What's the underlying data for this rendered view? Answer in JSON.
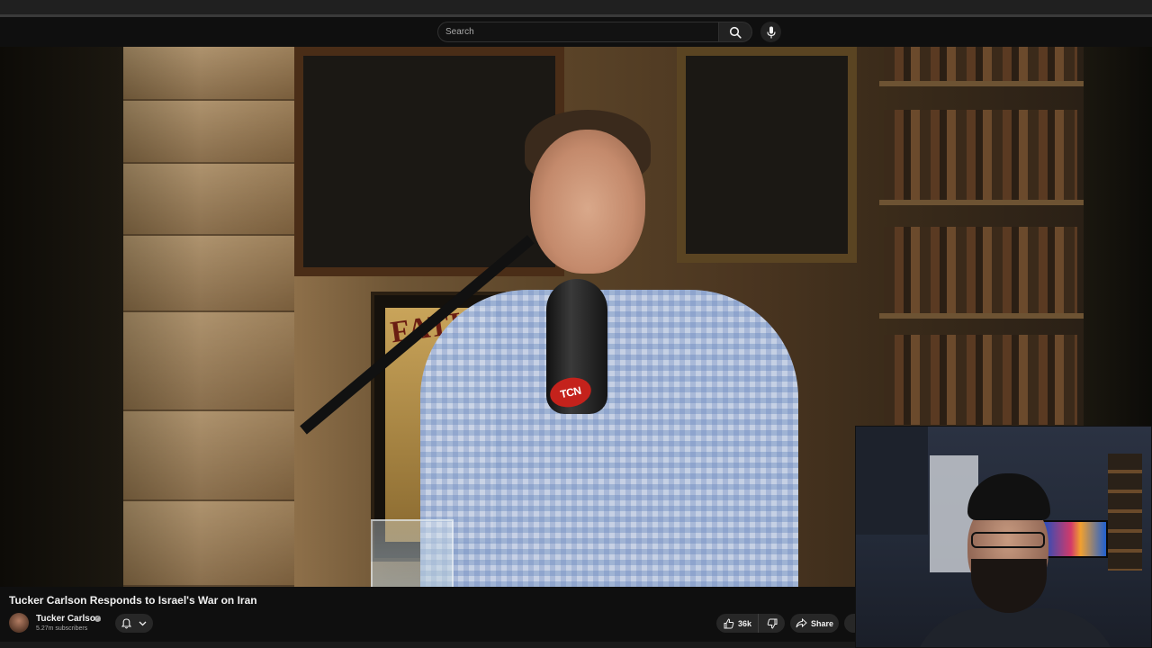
{
  "search": {
    "placeholder": "Search",
    "icon": "search-icon",
    "mic_icon": "microphone-icon"
  },
  "video": {
    "title": "Tucker Carlson Responds to Israel's War on Iran",
    "mic_badge": "TCN",
    "poster_text": "FATI"
  },
  "channel": {
    "name": "Tucker Carlson",
    "subscribers": "5.27m subscribers",
    "verified_icon": "verified-icon",
    "bell_icon": "bell-icon",
    "chevron_icon": "chevron-down-icon"
  },
  "actions": {
    "like_count": "36k",
    "share_label": "Share",
    "like_icon": "thumbs-up-icon",
    "dislike_icon": "thumbs-down-icon",
    "share_icon": "share-icon"
  },
  "colors": {
    "background": "#0f0f0f",
    "button_bg": "#272727",
    "text_primary": "#f1f1f1",
    "text_secondary": "#aaaaaa",
    "mic_badge": "#c4221c"
  }
}
